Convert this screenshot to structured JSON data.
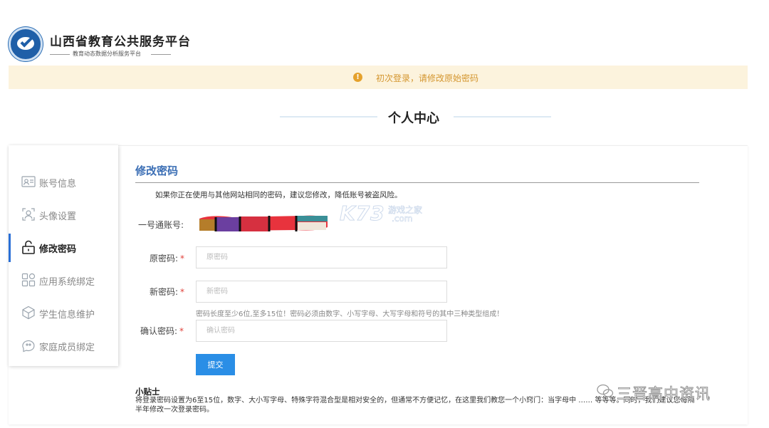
{
  "header": {
    "title": "山西省教育公共服务平台",
    "subtitle": "教育动态数据分析服务平台"
  },
  "notice": {
    "text": "初次登录，请修改原始密码"
  },
  "section_title": "个人中心",
  "sidebar": {
    "items": [
      {
        "label": "账号信息",
        "icon": "id-card-icon"
      },
      {
        "label": "头像设置",
        "icon": "avatar-icon"
      },
      {
        "label": "修改密码",
        "icon": "unlock-icon",
        "active": true
      },
      {
        "label": "应用系统绑定",
        "icon": "apps-icon"
      },
      {
        "label": "学生信息维护",
        "icon": "cube-icon"
      },
      {
        "label": "家庭成员绑定",
        "icon": "chat-users-icon"
      }
    ]
  },
  "form": {
    "title": "修改密码",
    "hint": "如果你正在使用与其他网站相同的密码，建议您修改，降低账号被盗风险。",
    "account_label": "一号通账号:",
    "old_password": {
      "label": "原密码:",
      "required": "*",
      "placeholder": "原密码"
    },
    "new_password": {
      "label": "新密码:",
      "required": "*",
      "placeholder": "新密码"
    },
    "password_rule": "密码长度至少6位,至多15位！密码必须由数字、小写字母、大写字母和符号的其中三种类型组成！",
    "confirm_password": {
      "label": "确认密码:",
      "required": "*",
      "placeholder": "确认密码"
    },
    "submit_label": "提交"
  },
  "tips": {
    "title": "小贴士",
    "text": "将登录密码设置为6至15位，数字、大小写字母、特殊字符混合型是相对安全的，但通常不方便记忆，在这里我们教您一个小窍门：当字母中 …… 等等等。同时，我们建议您每隔半年修改一次登录密码。"
  },
  "watermarks": {
    "k73": "K73",
    "k73_cn": "游戏之家",
    "k73_com": ".com",
    "wechat": "三晋高中资讯"
  },
  "colors": {
    "accent_blue": "#3c6fb5",
    "button_blue": "#2a8ee6",
    "notice_bg": "#fcf3dd",
    "notice_text": "#d4962f",
    "required_red": "#e0413a"
  }
}
